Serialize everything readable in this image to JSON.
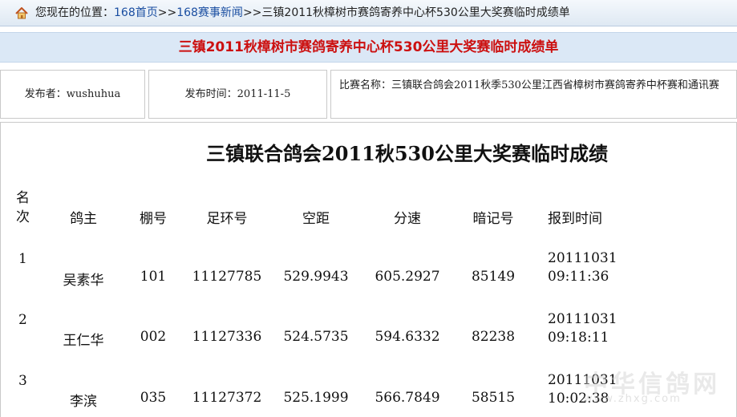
{
  "breadcrumb": {
    "prefix": "您现在的位置：",
    "links": [
      "168首页",
      "168赛事新闻"
    ],
    "separator": ">>",
    "current": "三镇2011秋樟树市赛鸽寄养中心杯530公里大奖赛临时成绩单"
  },
  "banner_title": "三镇2011秋樟树市赛鸽寄养中心杯530公里大奖赛临时成绩单",
  "info": {
    "publisher": "发布者：wushuhua",
    "publish_time": "发布时间：2011-11-5",
    "race_name": "比赛名称：三镇联合鸽会2011秋季530公里江西省樟树市赛鸽寄养中杯赛和通讯赛"
  },
  "results": {
    "title": "三镇联合鸽会2011秋530公里大奖赛临时成绩",
    "headers": {
      "rank_1": "名",
      "rank_2": "次",
      "owner": "鸽主",
      "loft": "棚号",
      "ring": "足环号",
      "distance": "空距",
      "speed": "分速",
      "code": "暗记号",
      "arrival": "报到时间"
    },
    "rows": [
      {
        "rank": "1",
        "owner": "吴素华",
        "loft": "101",
        "ring": "11127785",
        "distance": "529.9943",
        "speed": "605.2927",
        "code": "85149",
        "date": "20111031",
        "time": "09:11:36"
      },
      {
        "rank": "2",
        "owner": "王仁华",
        "loft": "002",
        "ring": "11127336",
        "distance": "524.5735",
        "speed": "594.6332",
        "code": "82238",
        "date": "20111031",
        "time": "09:18:11"
      },
      {
        "rank": "3",
        "owner": "李滨",
        "loft": "035",
        "ring": "11127372",
        "distance": "525.1999",
        "speed": "566.7849",
        "code": "58515",
        "date": "20111031",
        "time": "10:02:38"
      }
    ]
  },
  "watermark": {
    "text": "中华信鸽网",
    "url": "www.zhxg.com"
  },
  "colors": {
    "banner_text": "#cc1010",
    "link": "#1a4ea1"
  },
  "icons": {
    "home": "home-icon"
  }
}
